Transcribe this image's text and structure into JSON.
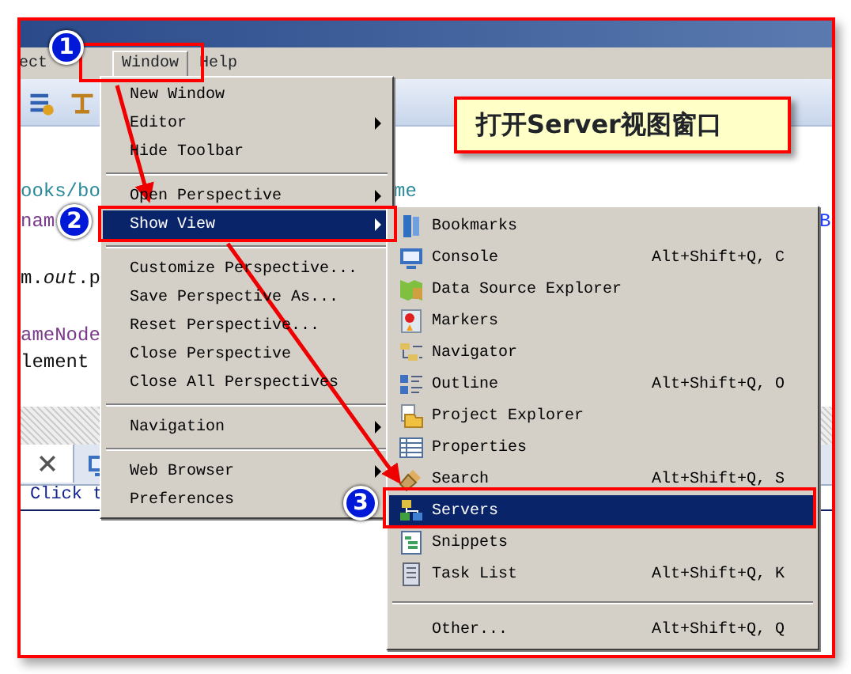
{
  "menubar": [
    {
      "label": "ect",
      "selected": false
    },
    {
      "label": "Window",
      "selected": true
    },
    {
      "label": "Help",
      "selected": false
    }
  ],
  "editor_lines": [
    {
      "text": "ooks/bo",
      "kind": "string"
    },
    {
      "text": "me",
      "kind": "string"
    },
    {
      "text": "nam",
      "kind": "field"
    },
    {
      "text": "B",
      "kind": "link"
    },
    {
      "text": "m.*out*.p",
      "kind": "plain"
    },
    {
      "text": "ameNode",
      "kind": "field"
    },
    {
      "text": "lement",
      "kind": "plain"
    }
  ],
  "bottom_panel": {
    "link_text": "Click t"
  },
  "window_menu": [
    {
      "kind": "item",
      "label": "New Window",
      "submenu": false,
      "selected": false
    },
    {
      "kind": "item",
      "label": "Editor",
      "submenu": true,
      "selected": false
    },
    {
      "kind": "item",
      "label": "Hide Toolbar",
      "submenu": false,
      "selected": false
    },
    {
      "kind": "separator"
    },
    {
      "kind": "item",
      "label": "Open Perspective",
      "submenu": true,
      "selected": false
    },
    {
      "kind": "item",
      "label": "Show View",
      "submenu": true,
      "selected": true
    },
    {
      "kind": "separator"
    },
    {
      "kind": "item",
      "label": "Customize Perspective...",
      "submenu": false,
      "selected": false
    },
    {
      "kind": "item",
      "label": "Save Perspective As...",
      "submenu": false,
      "selected": false
    },
    {
      "kind": "item",
      "label": "Reset Perspective...",
      "submenu": false,
      "selected": false
    },
    {
      "kind": "item",
      "label": "Close Perspective",
      "submenu": false,
      "selected": false
    },
    {
      "kind": "item",
      "label": "Close All Perspectives",
      "submenu": false,
      "selected": false
    },
    {
      "kind": "separator"
    },
    {
      "kind": "item",
      "label": "Navigation",
      "submenu": true,
      "selected": false
    },
    {
      "kind": "separator"
    },
    {
      "kind": "item",
      "label": "Web Browser",
      "submenu": true,
      "selected": false
    },
    {
      "kind": "item",
      "label": "Preferences",
      "submenu": false,
      "selected": false
    }
  ],
  "show_view_menu": [
    {
      "kind": "item",
      "label": "Bookmarks",
      "selected": false
    },
    {
      "kind": "item",
      "label": "Console",
      "shortcut": "Alt+Shift+Q, C",
      "selected": false
    },
    {
      "kind": "item",
      "label": "Data Source Explorer",
      "selected": false
    },
    {
      "kind": "item",
      "label": "Markers",
      "selected": false
    },
    {
      "kind": "item",
      "label": "Navigator",
      "selected": false
    },
    {
      "kind": "item",
      "label": "Outline",
      "shortcut": "Alt+Shift+Q, O",
      "selected": false
    },
    {
      "kind": "item",
      "label": "Project Explorer",
      "selected": false
    },
    {
      "kind": "item",
      "label": "Properties",
      "selected": false
    },
    {
      "kind": "item",
      "label": "Search",
      "shortcut": "Alt+Shift+Q, S",
      "selected": false
    },
    {
      "kind": "item",
      "label": "Servers",
      "selected": true
    },
    {
      "kind": "item",
      "label": "Snippets",
      "selected": false
    },
    {
      "kind": "item",
      "label": "Task List",
      "shortcut": "Alt+Shift+Q, K",
      "selected": false
    },
    {
      "kind": "separator"
    },
    {
      "kind": "item",
      "label": "Other...",
      "shortcut": "Alt+Shift+Q, Q",
      "selected": false
    }
  ],
  "annotations": {
    "callout": "打开Server视图窗口",
    "steps": [
      "1",
      "2",
      "3"
    ]
  }
}
